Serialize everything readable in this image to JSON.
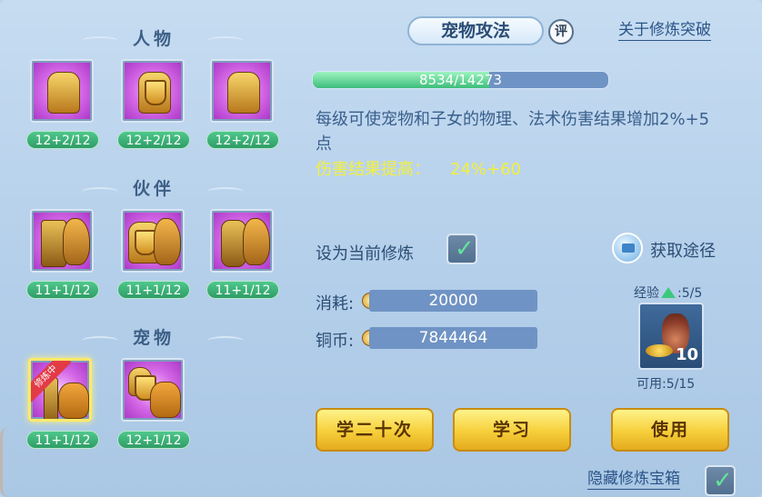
{
  "sections": {
    "character": {
      "title": "人物",
      "skills": [
        {
          "level": "12+2/12"
        },
        {
          "level": "12+2/12"
        },
        {
          "level": "12+2/12"
        }
      ]
    },
    "partner": {
      "title": "伙伴",
      "skills": [
        {
          "level": "11+1/12"
        },
        {
          "level": "11+1/12"
        },
        {
          "level": "11+1/12"
        }
      ]
    },
    "pet": {
      "title": "宠物",
      "skills": [
        {
          "level": "11+1/12",
          "ribbon": "修炼中"
        },
        {
          "level": "12+1/12"
        }
      ]
    }
  },
  "detail": {
    "tab_title": "宠物攻法",
    "rate_badge": "评",
    "breakthrough_link": "关于修炼突破",
    "exp_text": "8534/14273",
    "exp_progress": 0.598,
    "description": "每级可使宠物和子女的物理、法术伤害结果增加2%+5点",
    "effect_label": "伤害结果提高：",
    "effect_value": "24%+60",
    "set_current_label": "设为当前修炼",
    "set_current_checked": true,
    "obtain_label": "获取途径",
    "cost_label": "消耗:",
    "cost_value": "20000",
    "coins_label": "铜币:",
    "coins_value": "7844464"
  },
  "item": {
    "exp_label": "经验",
    "exp_count": ":5/5",
    "count": "10",
    "available": "可用:5/15"
  },
  "buttons": {
    "learn20": "学二十次",
    "learn": "学习",
    "use": "使用"
  },
  "hide_box": {
    "label": "隐藏修炼宝箱",
    "checked": true
  },
  "colors": {
    "level_badge": "#3db97a",
    "skill_bg": "#c44fdc",
    "button": "#f6cf3a",
    "effect_text": "#f2ef3d"
  }
}
